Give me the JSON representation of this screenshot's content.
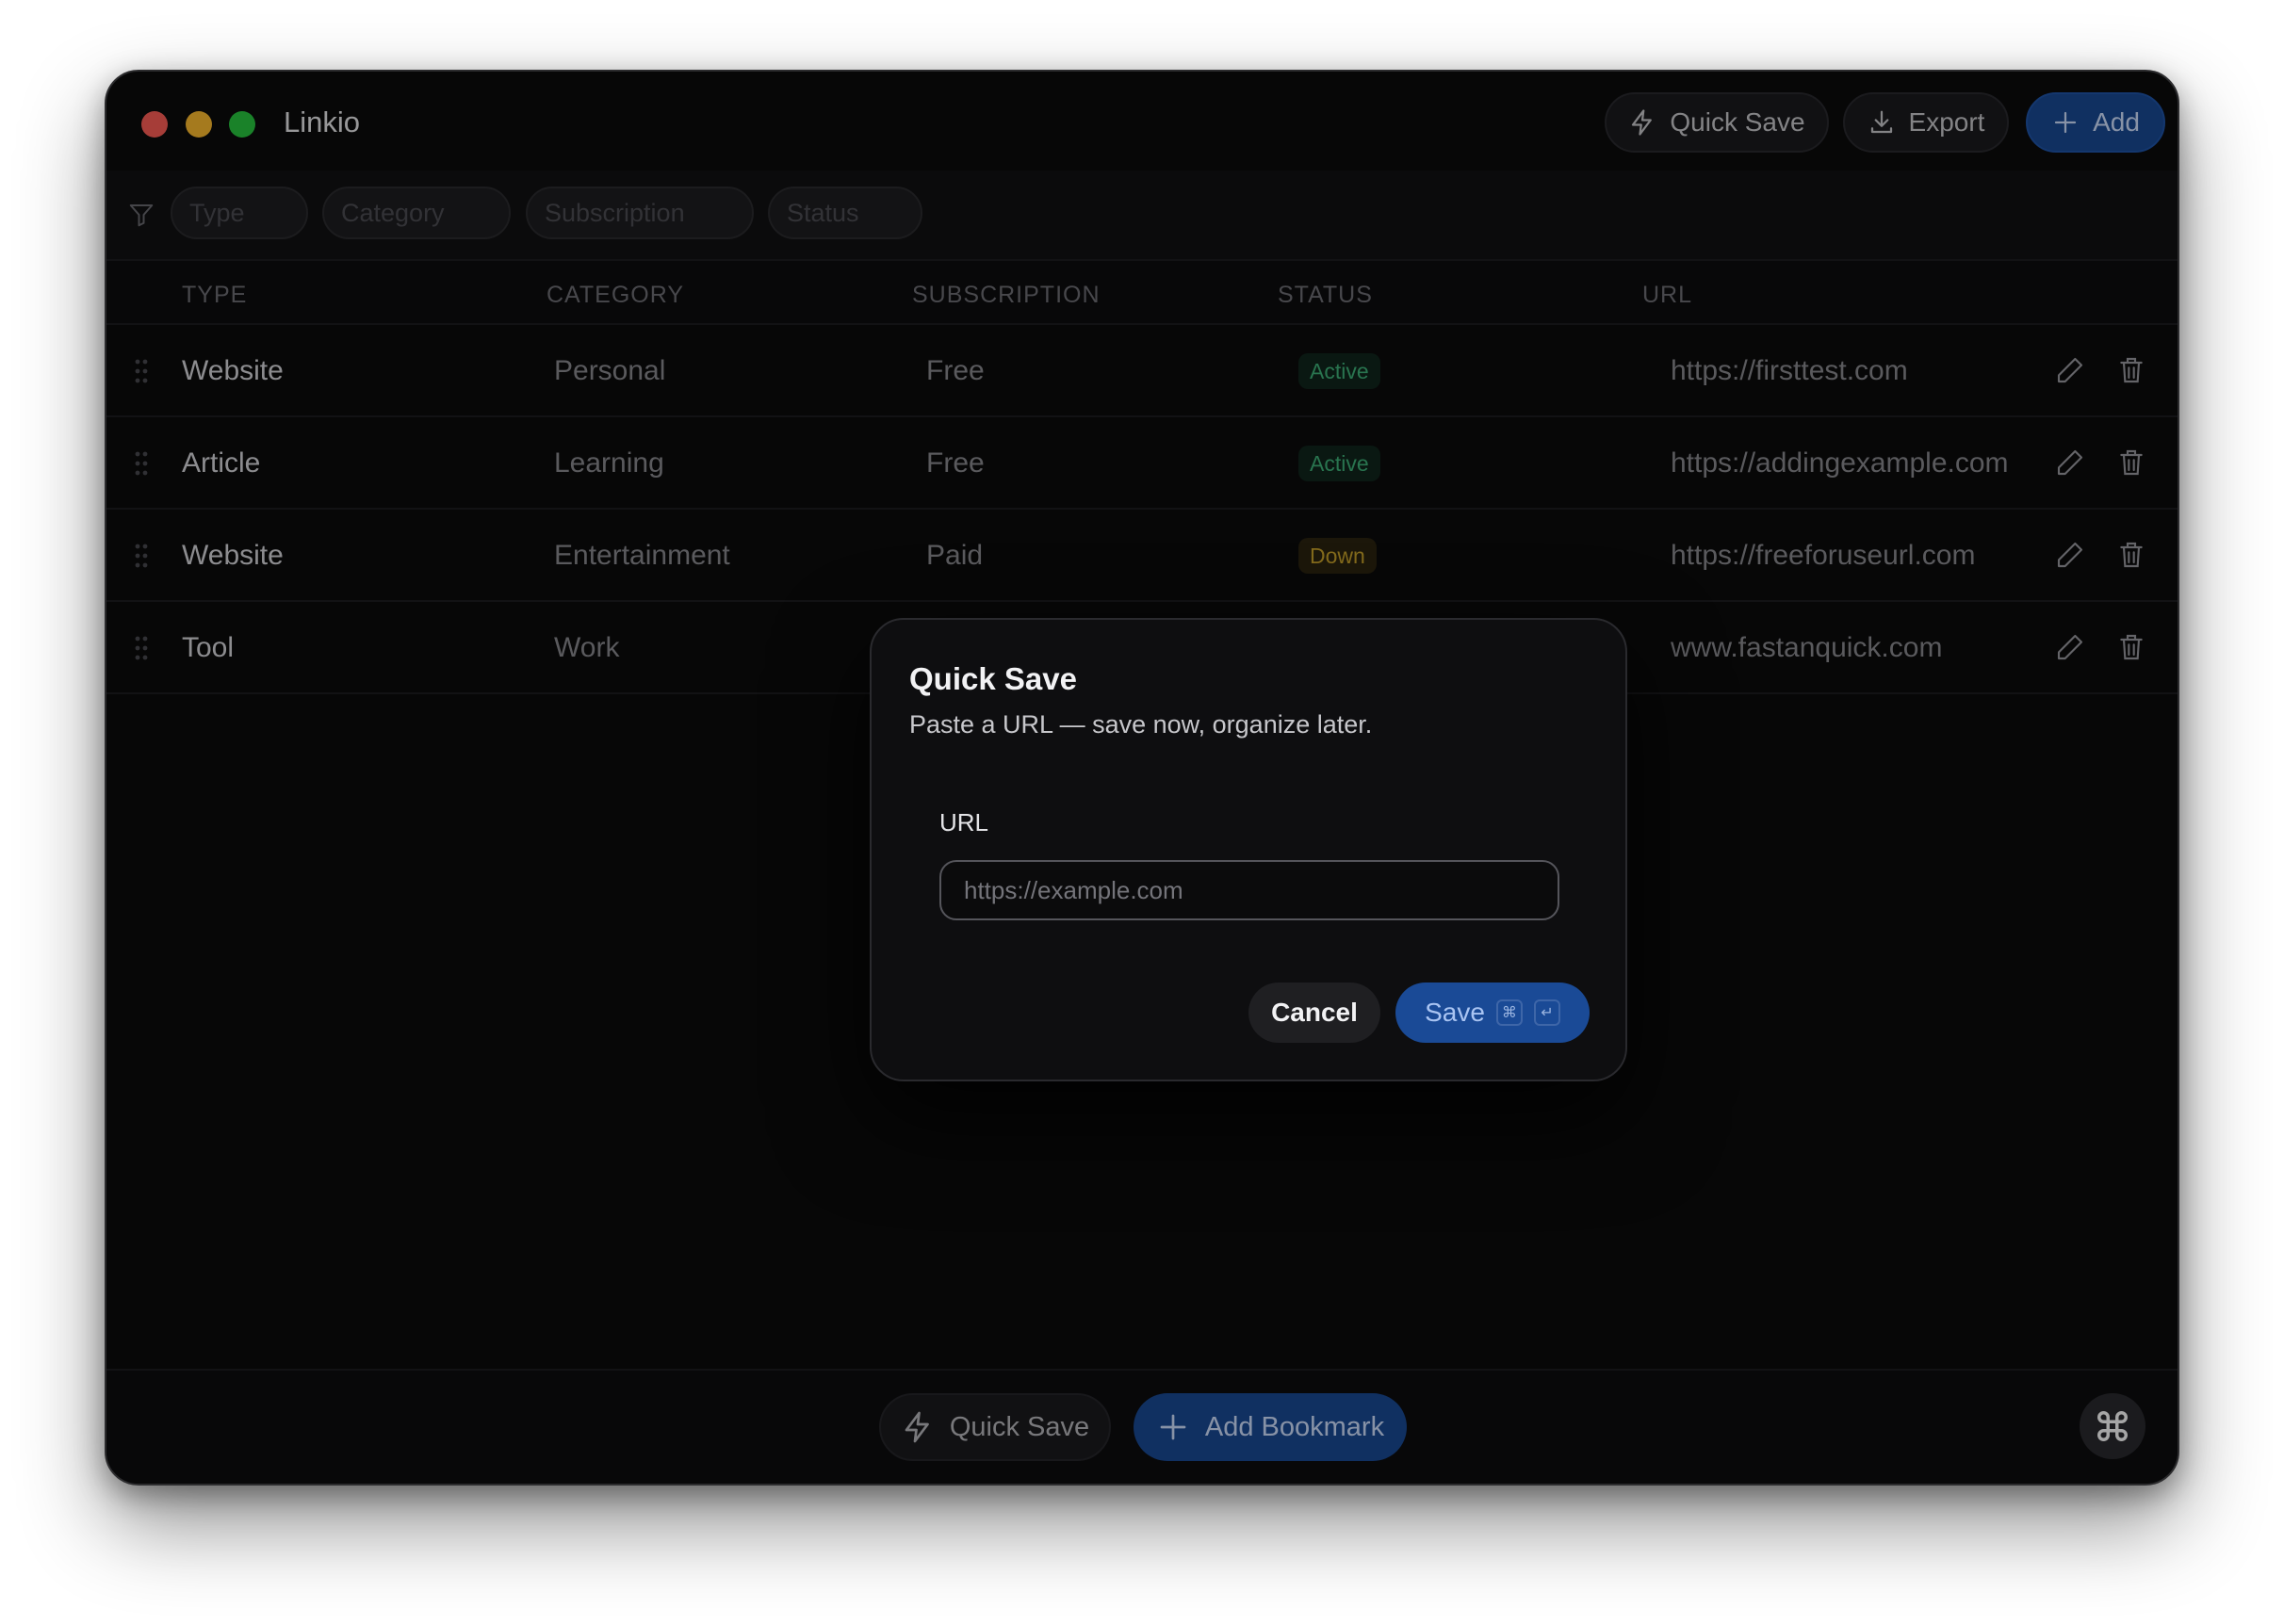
{
  "app": {
    "title": "Linkio"
  },
  "toolbar": {
    "quick_save": "Quick Save",
    "export": "Export",
    "add": "Add"
  },
  "filters": [
    {
      "label": "Type"
    },
    {
      "label": "Category"
    },
    {
      "label": "Subscription"
    },
    {
      "label": "Status"
    }
  ],
  "table": {
    "columns": [
      "TYPE",
      "CATEGORY",
      "SUBSCRIPTION",
      "STATUS",
      "URL"
    ],
    "rows": [
      {
        "type": "Website",
        "category": "Personal",
        "subscription": "Free",
        "status": "Active",
        "url": "https://firsttest.com"
      },
      {
        "type": "Article",
        "category": "Learning",
        "subscription": "Free",
        "status": "Active",
        "url": "https://addingexample.com"
      },
      {
        "type": "Website",
        "category": "Entertainment",
        "subscription": "Paid",
        "status": "Down",
        "url": "https://freeforuseurl.com"
      },
      {
        "type": "Tool",
        "category": "Work",
        "subscription": "",
        "status": "",
        "url": "www.fastanquick.com"
      }
    ]
  },
  "bottombar": {
    "quick_save": "Quick Save",
    "add_bookmark": "Add Bookmark"
  },
  "modal": {
    "title": "Quick Save",
    "subtitle": "Paste a URL — save now, organize later.",
    "url_label": "URL",
    "url_placeholder": "https://example.com",
    "url_value": "",
    "cancel": "Cancel",
    "save": "Save",
    "shortcut_cmd": "⌘",
    "shortcut_enter": "↵"
  },
  "colors": {
    "accent": "#1a4a96",
    "active": "#3fb37a",
    "down": "#c9a32c"
  }
}
